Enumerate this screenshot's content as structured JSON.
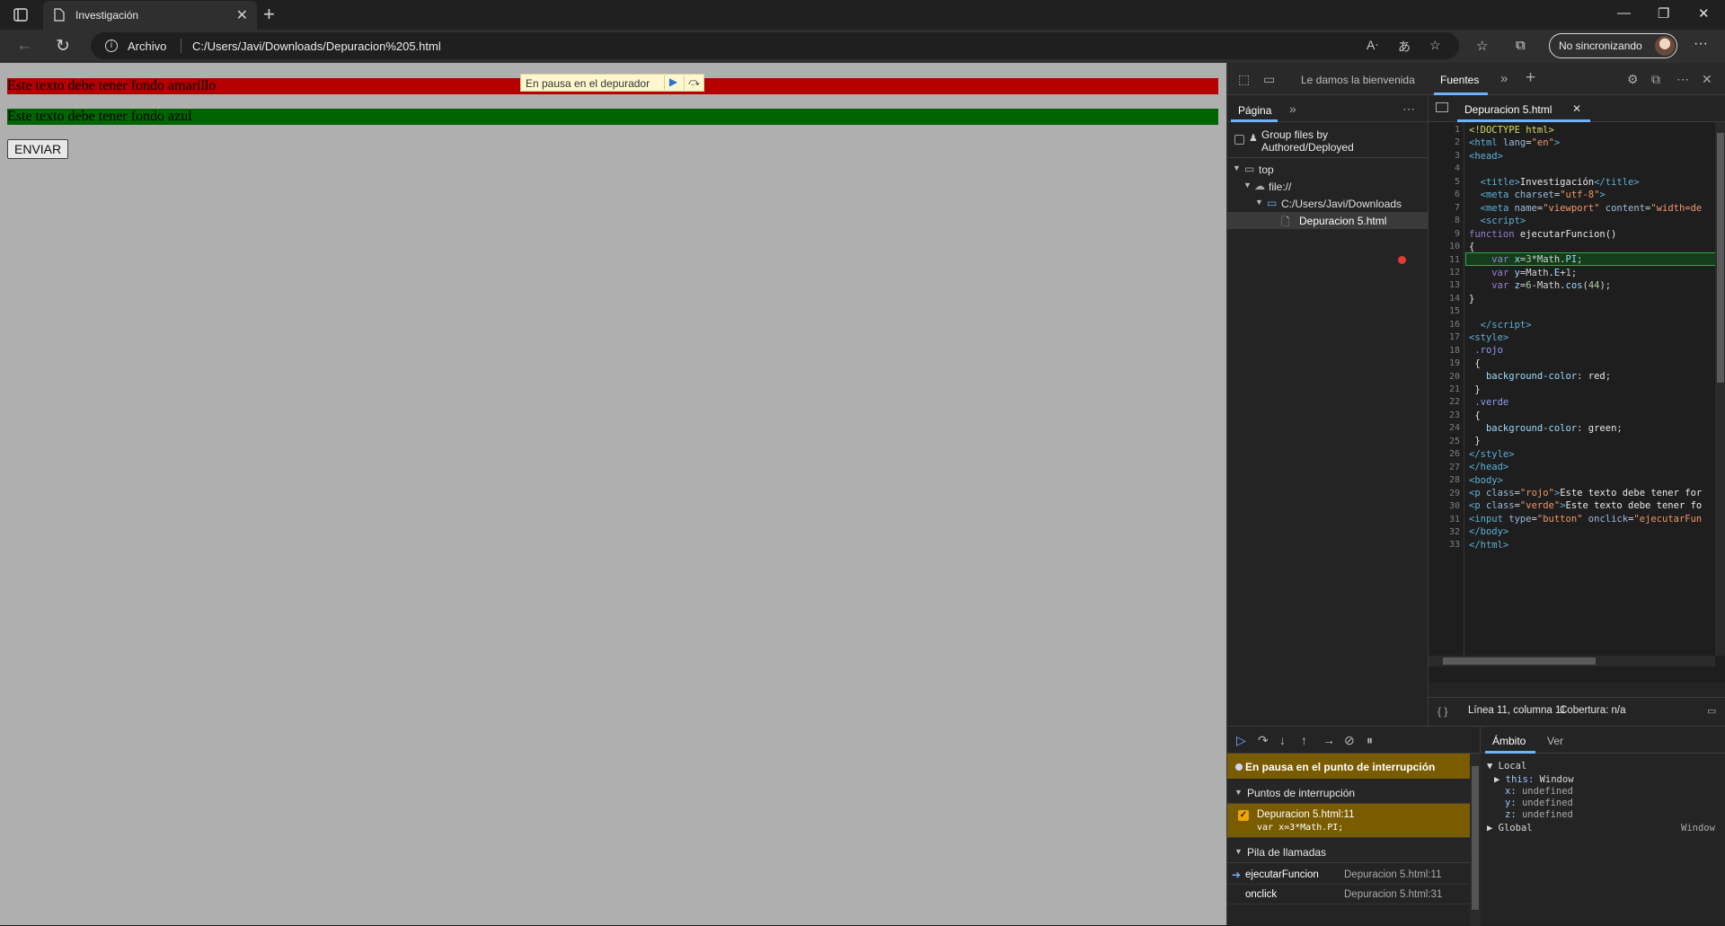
{
  "browser": {
    "tab_title": "Investigación",
    "address_scheme": "Archivo",
    "address_url": "C:/Users/Javi/Downloads/Depuracion%205.html",
    "profile_label": "No sincronizando"
  },
  "page": {
    "p_rojo": "Este texto debe tener fondo amarillo",
    "p_verde": "Este texto debe tener fondo azul",
    "button_label": "ENVIAR",
    "paused_overlay": "En pausa en el depurador"
  },
  "devtools": {
    "welcome_tab": "Le damos la bienvenida",
    "sources_tab": "Fuentes",
    "navigator": {
      "tab_label": "Página",
      "group_label": "Group files by Authored/Deployed",
      "tree": [
        "top",
        "file://",
        "C:/Users/Javi/Downloads",
        "Depuracion 5.html"
      ]
    },
    "editor": {
      "file_tab": "Depuracion 5.html",
      "breakpoint_line": 11,
      "line_numbers": [
        "1",
        "2",
        "3",
        "4",
        "5",
        "6",
        "7",
        "8",
        "9",
        "10",
        "11",
        "12",
        "13",
        "14",
        "15",
        "16",
        "17",
        "18",
        "19",
        "20",
        "21",
        "22",
        "23",
        "24",
        "25",
        "26",
        "27",
        "28",
        "29",
        "30",
        "31",
        "32",
        "33"
      ]
    },
    "status": {
      "position": "Línea 11, columna 11",
      "coverage": "Cobertura: n/a"
    },
    "debugger": {
      "paused_message": "En pausa en el punto de interrupción",
      "breakpoints_header": "Puntos de interrupción",
      "breakpoint_file": "Depuracion 5.html:11",
      "breakpoint_code": "var x=3*Math.PI;",
      "callstack_header": "Pila de llamadas",
      "callstack": [
        {
          "fn": "ejecutarFuncion",
          "loc": "Depuracion 5.html:11"
        },
        {
          "fn": "onclick",
          "loc": "Depuracion 5.html:31"
        }
      ]
    },
    "scope": {
      "tab_scope": "Ámbito",
      "tab_watch": "Ver",
      "local_label": "Local",
      "this_key": "this:",
      "this_val": "Window",
      "x_key": "x:",
      "x_val": "undefined",
      "y_key": "y:",
      "y_val": "undefined",
      "z_key": "z:",
      "z_val": "undefined",
      "global_label": "Global",
      "global_val": "Window"
    }
  }
}
